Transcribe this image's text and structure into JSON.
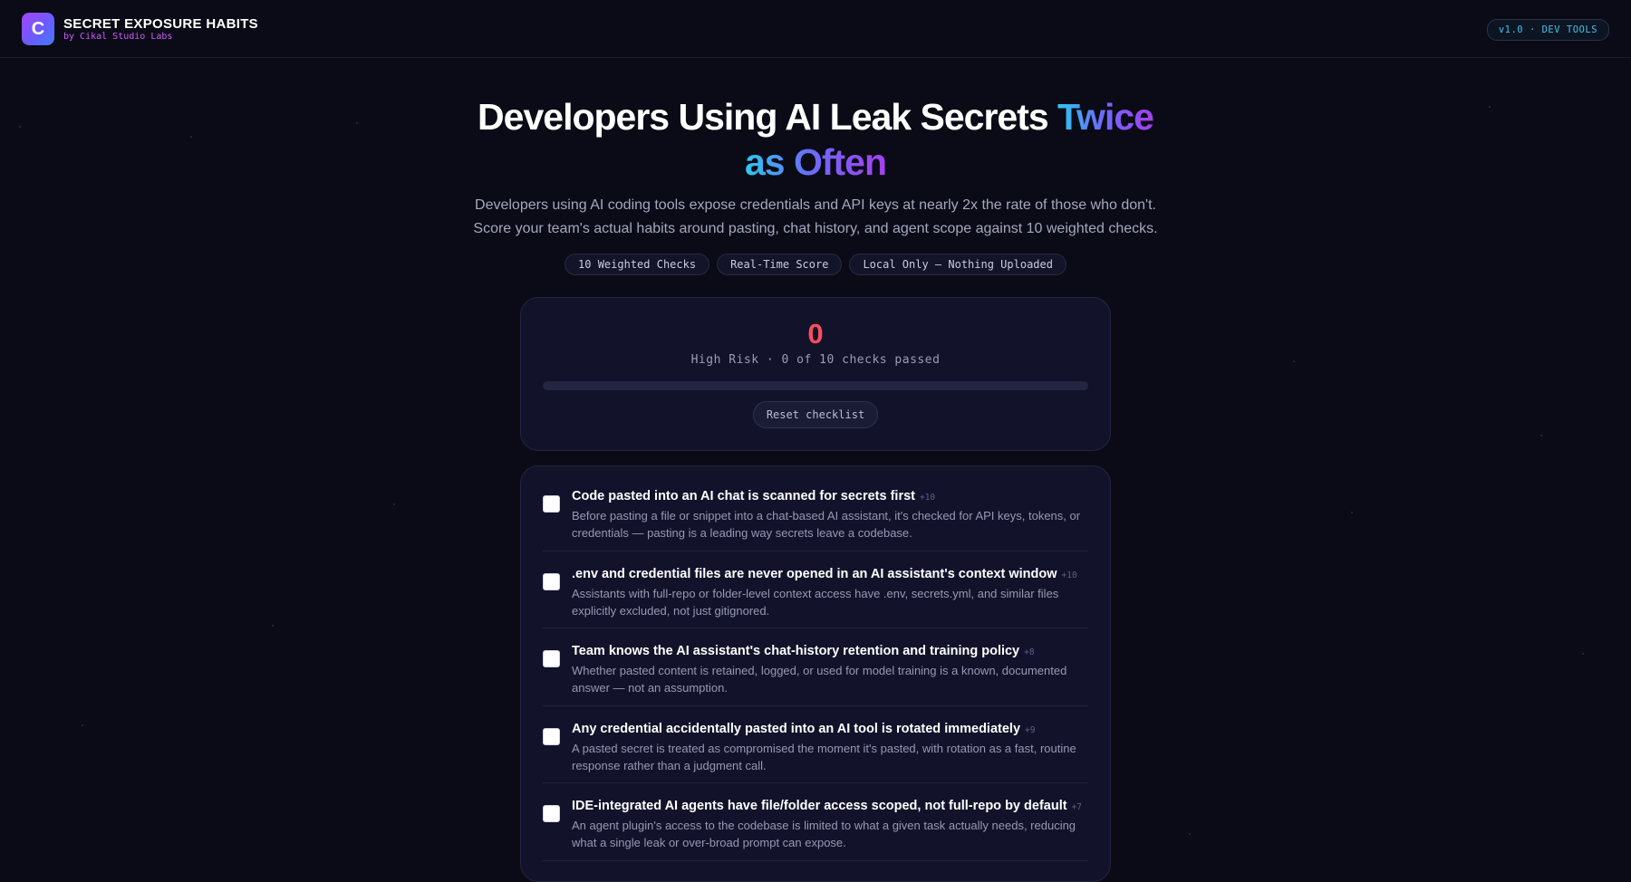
{
  "header": {
    "logo_letter": "C",
    "title": "SECRET EXPOSURE HABITS",
    "subtitle": "by Cikal Studio Labs",
    "version_badge": "v1.0 · DEV TOOLS"
  },
  "hero": {
    "title_plain": "Developers Using AI Leak Secrets ",
    "title_highlight_1": "Twice",
    "title_highlight_2": "as Often",
    "subtitle": "Developers using AI coding tools expose credentials and API keys at nearly 2x the rate of those who don't. Score your team's actual habits around pasting, chat history, and agent scope against 10 weighted checks.",
    "pills": [
      "10 Weighted Checks",
      "Real-Time Score",
      "Local Only — Nothing Uploaded"
    ]
  },
  "score": {
    "value": "0",
    "label": "High Risk · 0 of 10 checks passed",
    "progress_fraction": 0,
    "reset_label": "Reset checklist"
  },
  "checklist": [
    {
      "title": "Code pasted into an AI chat is scanned for secrets first",
      "weight": "+10",
      "description": "Before pasting a file or snippet into a chat-based AI assistant, it's checked for API keys, tokens, or credentials — pasting is a leading way secrets leave a codebase.",
      "checked": false
    },
    {
      "title": ".env and credential files are never opened in an AI assistant's context window",
      "weight": "+10",
      "description": "Assistants with full-repo or folder-level context access have .env, secrets.yml, and similar files explicitly excluded, not just gitignored.",
      "checked": false
    },
    {
      "title": "Team knows the AI assistant's chat-history retention and training policy",
      "weight": "+8",
      "description": "Whether pasted content is retained, logged, or used for model training is a known, documented answer — not an assumption.",
      "checked": false
    },
    {
      "title": "Any credential accidentally pasted into an AI tool is rotated immediately",
      "weight": "+9",
      "description": "A pasted secret is treated as compromised the moment it's pasted, with rotation as a fast, routine response rather than a judgment call.",
      "checked": false
    },
    {
      "title": "IDE-integrated AI agents have file/folder access scoped, not full-repo by default",
      "weight": "+7",
      "description": "An agent plugin's access to the codebase is limited to what a given task actually needs, reducing what a single leak or over-broad prompt can expose.",
      "checked": false
    }
  ],
  "colors": {
    "background": "#0a0b16",
    "score_risk": "#ff4d5e",
    "accent_cyan": "#2ec8f0",
    "accent_purple": "#a53ff0"
  }
}
